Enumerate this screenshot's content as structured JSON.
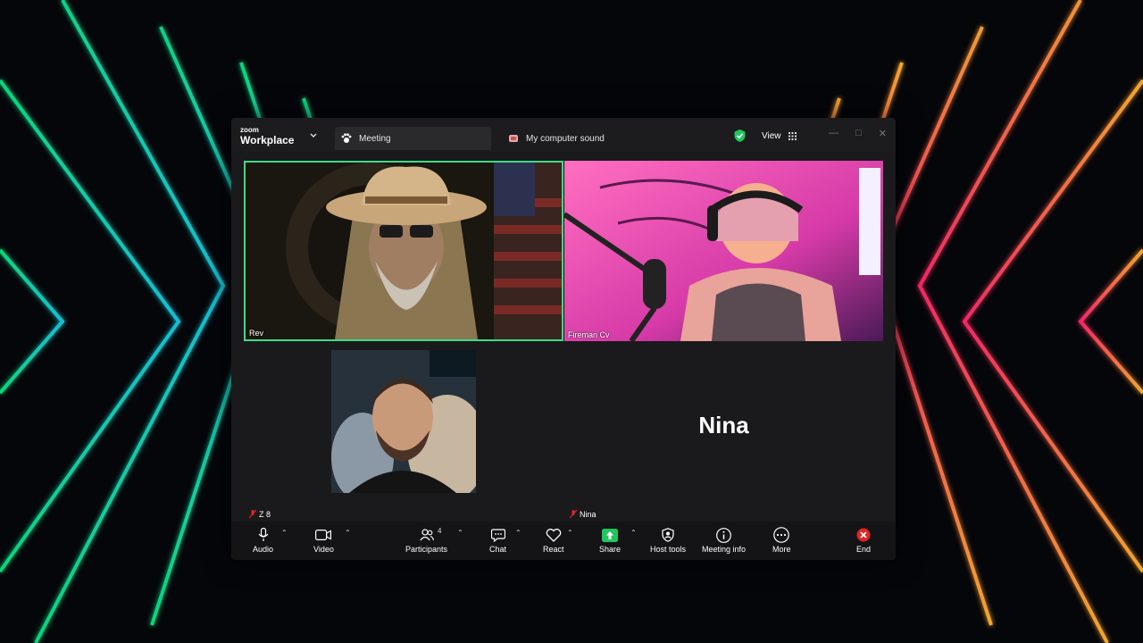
{
  "app": {
    "brand_small": "zoom",
    "brand_big": "Workplace"
  },
  "tabs": {
    "meeting": "Meeting",
    "computer_sound": "My computer sound"
  },
  "header": {
    "view_label": "View"
  },
  "participants": {
    "rev": "Rev",
    "fireman": "Fireman Cv",
    "z": "Z 8",
    "nina_label": "Nina",
    "nina_big": "Nina"
  },
  "toolbar": {
    "audio": "Audio",
    "video": "Video",
    "participants": "Participants",
    "participants_count": "4",
    "chat": "Chat",
    "react": "React",
    "share": "Share",
    "host_tools": "Host tools",
    "meeting_info": "Meeting info",
    "more": "More",
    "end": "End"
  },
  "colors": {
    "active_speaker": "#3ddc84",
    "share_green": "#22c55e",
    "end_red": "#e02424"
  },
  "icons": [
    "microphone-icon",
    "camera-icon",
    "participants-icon",
    "chat-icon",
    "heart-icon",
    "share-arrow-icon",
    "shield-icon",
    "info-icon",
    "more-icon",
    "end-icon",
    "shield-check-icon",
    "grid-icon",
    "muted-mic-icon"
  ]
}
